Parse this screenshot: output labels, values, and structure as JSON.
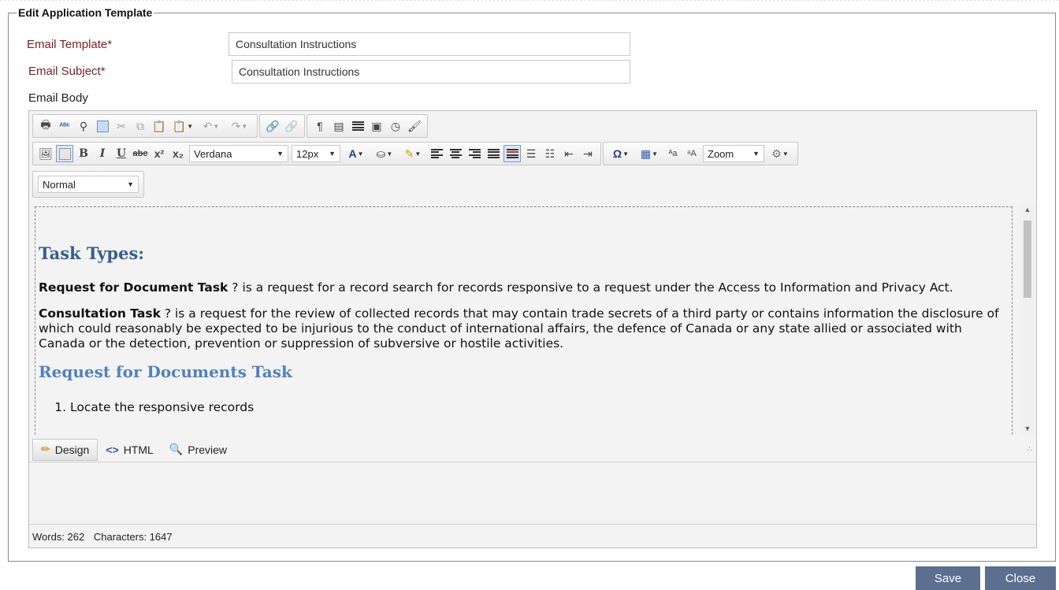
{
  "form": {
    "legend": "Edit Application Template",
    "template_label": "Email Template*",
    "template_value": "Consultation Instructions",
    "subject_label": "Email Subject*",
    "subject_value": "Consultation Instructions",
    "body_label": "Email Body"
  },
  "toolbar": {
    "font_family": "Verdana",
    "font_size": "12px",
    "zoom": "Zoom",
    "paragraph_format": "Normal"
  },
  "content": {
    "heading1": "Task Types:",
    "p1_bold": "Request for Document Task",
    "p1_text": " ? is a request for a record search for records responsive to a request under the Access to Information and Privacy Act.",
    "p2_bold": "Consultation Task",
    "p2_text": " ? is a request for the review of collected records that may contain trade secrets of a third party or contains information the disclosure of which could reasonably be expected to be injurious to the conduct of international affairs, the defence of Canada or any state allied or associated with Canada or the detection, prevention or suppression of subversive or hostile activities.",
    "heading2": "Request for Documents Task",
    "list_item_1": "Locate the responsive records"
  },
  "modes": {
    "design": "Design",
    "html": "HTML",
    "preview": "Preview"
  },
  "status": {
    "words": "Words: 262",
    "characters": "Characters: 1647"
  },
  "buttons": {
    "save": "Save",
    "close": "Close"
  }
}
